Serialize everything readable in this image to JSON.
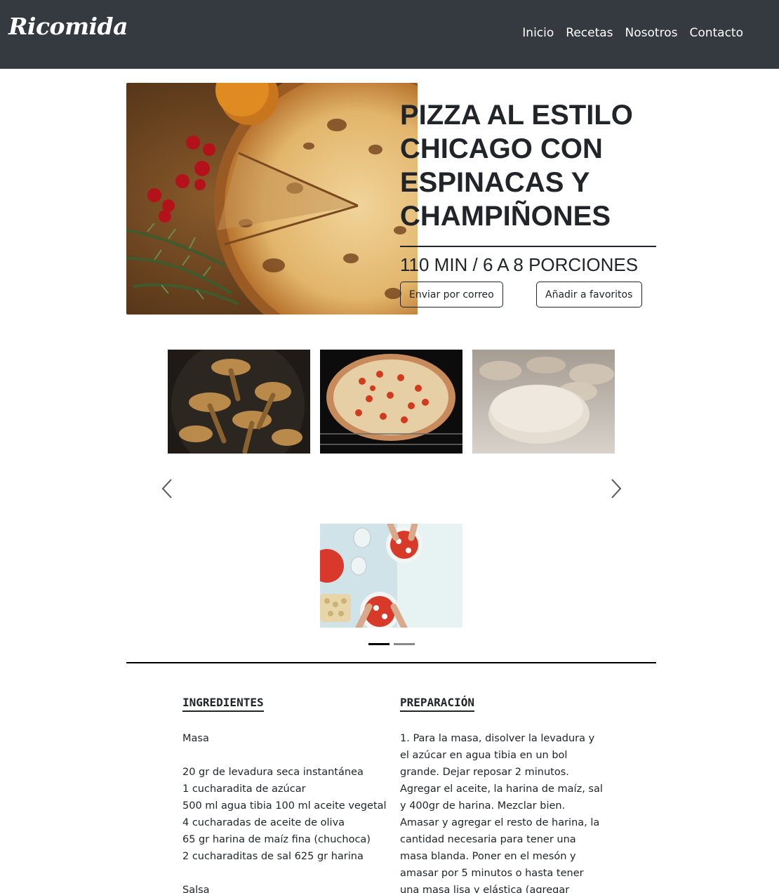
{
  "navbar": {
    "brand": "Ricomida",
    "links": [
      "Inicio",
      "Recetas",
      "Nosotros",
      "Contacto"
    ]
  },
  "hero": {
    "title": "Pizza al estilo Chicago con espinacas y champiñones",
    "meta": "110 min / 6 a 8 porciones",
    "email_button": "Enviar por correo",
    "favorite_button": "Añadir a favoritos"
  },
  "carousel": {
    "images": [
      "pizza-hero-photo",
      "mushrooms-photo",
      "pizza-oven-photo",
      "dough-photo",
      "pizza-making-photo"
    ],
    "indicators": 2,
    "active_indicator": 0
  },
  "ingredients": {
    "title": "INGREDIENTES",
    "lines": [
      "Masa",
      "",
      "20 gr de levadura seca instantánea",
      "1 cucharadita de azúcar",
      "500 ml agua tibia 100 ml aceite vegetal",
      "4 cucharadas de aceite de oliva",
      "65 gr harina de maíz fina (chuchoca)",
      "2 cucharaditas de sal 625 gr harina",
      "",
      "Salsa"
    ]
  },
  "preparation": {
    "title": "PREPARACIÓN",
    "text": "1. Para la masa, disolver la levadura y el azúcar en agua tibia en un bol grande. Dejar reposar 2 minutos. Agregar el aceite, la harina de maíz, sal y 400gr de harina. Mezclar bien. Amasar y agregar el resto de harina, la cantidad necesaria para tener una masa blanda. Poner en el mesón y amasar por 5 minutos o hasta tener una masa lisa y elástica (agregar harina en el mesón a medida que se va"
  },
  "colors": {
    "navbar_bg": "#343a40",
    "text": "#212529",
    "white": "#ffffff"
  }
}
